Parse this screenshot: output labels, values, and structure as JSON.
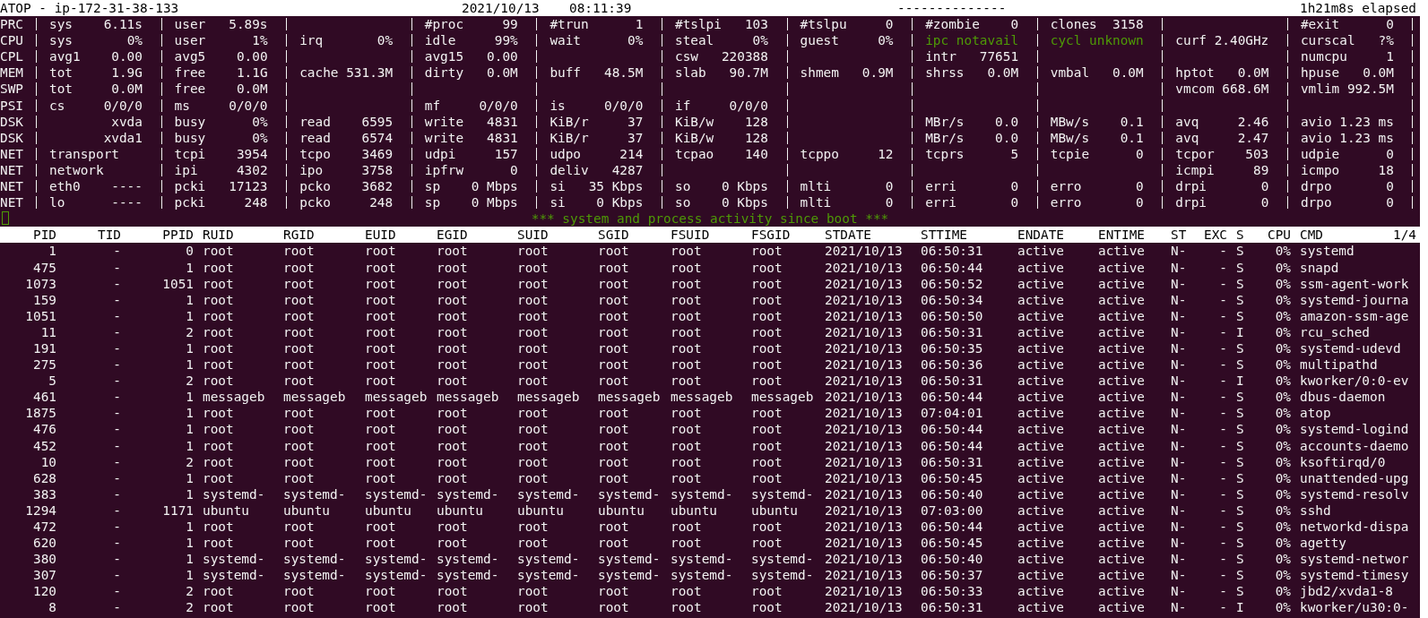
{
  "title_bar": {
    "title": "ATOP - ip-172-31-38-133",
    "date": "2021/10/13",
    "time": "08:11:39",
    "separator": "--------------",
    "elapsed": "1h21m8s elapsed"
  },
  "system_rows": [
    {
      "label": "PRC",
      "cells": [
        {
          "kind": "metric",
          "name": "sys",
          "value": "6.11s"
        },
        {
          "kind": "metric",
          "name": "user",
          "value": "5.89s"
        },
        {
          "kind": "blank"
        },
        {
          "kind": "metric",
          "name": "#proc",
          "value": "99"
        },
        {
          "kind": "metric",
          "name": "#trun",
          "value": "1"
        },
        {
          "kind": "metric",
          "name": "#tslpi",
          "value": "103"
        },
        {
          "kind": "metric",
          "name": "#tslpu",
          "value": "0"
        },
        {
          "kind": "metric",
          "name": "#zombie",
          "value": "0"
        },
        {
          "kind": "metric",
          "name": "clones",
          "value": "3158"
        },
        {
          "kind": "blank"
        },
        {
          "kind": "metric",
          "name": "#exit",
          "value": "0"
        }
      ]
    },
    {
      "label": "CPU",
      "cells": [
        {
          "kind": "metric",
          "name": "sys",
          "value": "0%"
        },
        {
          "kind": "metric",
          "name": "user",
          "value": "1%"
        },
        {
          "kind": "metric",
          "name": "irq",
          "value": "0%"
        },
        {
          "kind": "metric",
          "name": "idle",
          "value": "99%"
        },
        {
          "kind": "metric",
          "name": "wait",
          "value": "0%"
        },
        {
          "kind": "metric",
          "name": "steal",
          "value": "0%"
        },
        {
          "kind": "metric",
          "name": "guest",
          "value": "0%"
        },
        {
          "kind": "notice",
          "text": "ipc notavail"
        },
        {
          "kind": "notice",
          "text": "cycl unknown"
        },
        {
          "kind": "metric",
          "name": "curf",
          "value": "2.40GHz"
        },
        {
          "kind": "metric",
          "name": "curscal",
          "value": "?%"
        }
      ]
    },
    {
      "label": "CPL",
      "cells": [
        {
          "kind": "metric",
          "name": "avg1",
          "value": "0.00"
        },
        {
          "kind": "metric",
          "name": "avg5",
          "value": "0.00"
        },
        {
          "kind": "blank"
        },
        {
          "kind": "metric",
          "name": "avg15",
          "value": "0.00"
        },
        {
          "kind": "blank"
        },
        {
          "kind": "metric",
          "name": "csw",
          "value": "220388"
        },
        {
          "kind": "blank"
        },
        {
          "kind": "metric",
          "name": "intr",
          "value": "77651"
        },
        {
          "kind": "blank"
        },
        {
          "kind": "blank"
        },
        {
          "kind": "metric",
          "name": "numcpu",
          "value": "1"
        }
      ]
    },
    {
      "label": "MEM",
      "cells": [
        {
          "kind": "metric",
          "name": "tot",
          "value": "1.9G"
        },
        {
          "kind": "metric",
          "name": "free",
          "value": "1.1G"
        },
        {
          "kind": "metric",
          "name": "cache",
          "value": "531.3M"
        },
        {
          "kind": "metric",
          "name": "dirty",
          "value": "0.0M"
        },
        {
          "kind": "metric",
          "name": "buff",
          "value": "48.5M"
        },
        {
          "kind": "metric",
          "name": "slab",
          "value": "90.7M"
        },
        {
          "kind": "metric",
          "name": "shmem",
          "value": "0.9M"
        },
        {
          "kind": "metric",
          "name": "shrss",
          "value": "0.0M"
        },
        {
          "kind": "metric",
          "name": "vmbal",
          "value": "0.0M"
        },
        {
          "kind": "metric",
          "name": "hptot",
          "value": "0.0M"
        },
        {
          "kind": "metric",
          "name": "hpuse",
          "value": "0.0M"
        }
      ]
    },
    {
      "label": "SWP",
      "cells": [
        {
          "kind": "metric",
          "name": "tot",
          "value": "0.0M"
        },
        {
          "kind": "metric",
          "name": "free",
          "value": "0.0M"
        },
        {
          "kind": "blank"
        },
        {
          "kind": "blank"
        },
        {
          "kind": "blank"
        },
        {
          "kind": "blank"
        },
        {
          "kind": "blank"
        },
        {
          "kind": "blank"
        },
        {
          "kind": "blank"
        },
        {
          "kind": "metric",
          "name": "vmcom",
          "value": "668.6M"
        },
        {
          "kind": "metric",
          "name": "vmlim",
          "value": "992.5M"
        }
      ]
    },
    {
      "label": "PSI",
      "cells": [
        {
          "kind": "metric",
          "name": "cs",
          "value": "0/0/0"
        },
        {
          "kind": "metric",
          "name": "ms",
          "value": "0/0/0"
        },
        {
          "kind": "blank"
        },
        {
          "kind": "metric",
          "name": "mf",
          "value": "0/0/0"
        },
        {
          "kind": "metric",
          "name": "is",
          "value": "0/0/0"
        },
        {
          "kind": "metric",
          "name": "if",
          "value": "0/0/0"
        },
        {
          "kind": "blank"
        },
        {
          "kind": "blank"
        },
        {
          "kind": "blank"
        },
        {
          "kind": "blank"
        },
        {
          "kind": "blank"
        }
      ]
    },
    {
      "label": "DSK",
      "cells": [
        {
          "kind": "metric",
          "value": "xvda"
        },
        {
          "kind": "metric",
          "name": "busy",
          "value": "0%"
        },
        {
          "kind": "metric",
          "name": "read",
          "value": "6595"
        },
        {
          "kind": "metric",
          "name": "write",
          "value": "4831"
        },
        {
          "kind": "metric",
          "name": "KiB/r",
          "value": "37"
        },
        {
          "kind": "metric",
          "name": "KiB/w",
          "value": "128"
        },
        {
          "kind": "blank"
        },
        {
          "kind": "metric",
          "name": "MBr/s",
          "value": "0.0"
        },
        {
          "kind": "metric",
          "name": "MBw/s",
          "value": "0.1"
        },
        {
          "kind": "metric",
          "name": "avq",
          "value": "2.46"
        },
        {
          "kind": "metric",
          "name": "avio",
          "value": "1.23 ms"
        }
      ]
    },
    {
      "label": "DSK",
      "cells": [
        {
          "kind": "metric",
          "value": "xvda1"
        },
        {
          "kind": "metric",
          "name": "busy",
          "value": "0%"
        },
        {
          "kind": "metric",
          "name": "read",
          "value": "6574"
        },
        {
          "kind": "metric",
          "name": "write",
          "value": "4831"
        },
        {
          "kind": "metric",
          "name": "KiB/r",
          "value": "37"
        },
        {
          "kind": "metric",
          "name": "KiB/w",
          "value": "128"
        },
        {
          "kind": "blank"
        },
        {
          "kind": "metric",
          "name": "MBr/s",
          "value": "0.0"
        },
        {
          "kind": "metric",
          "name": "MBw/s",
          "value": "0.1"
        },
        {
          "kind": "metric",
          "name": "avq",
          "value": "2.47"
        },
        {
          "kind": "metric",
          "name": "avio",
          "value": "1.23 ms"
        }
      ]
    },
    {
      "label": "NET",
      "cells": [
        {
          "kind": "label",
          "text": "transport"
        },
        {
          "kind": "metric",
          "name": "tcpi",
          "value": "3954"
        },
        {
          "kind": "metric",
          "name": "tcpo",
          "value": "3469"
        },
        {
          "kind": "metric",
          "name": "udpi",
          "value": "157"
        },
        {
          "kind": "metric",
          "name": "udpo",
          "value": "214"
        },
        {
          "kind": "metric",
          "name": "tcpao",
          "value": "140"
        },
        {
          "kind": "metric",
          "name": "tcppo",
          "value": "12"
        },
        {
          "kind": "metric",
          "name": "tcprs",
          "value": "5"
        },
        {
          "kind": "metric",
          "name": "tcpie",
          "value": "0"
        },
        {
          "kind": "metric",
          "name": "tcpor",
          "value": "503"
        },
        {
          "kind": "metric",
          "name": "udpie",
          "value": "0"
        }
      ]
    },
    {
      "label": "NET",
      "cells": [
        {
          "kind": "label",
          "text": "network"
        },
        {
          "kind": "metric",
          "name": "ipi",
          "value": "4302"
        },
        {
          "kind": "metric",
          "name": "ipo",
          "value": "3758"
        },
        {
          "kind": "metric",
          "name": "ipfrw",
          "value": "0"
        },
        {
          "kind": "metric",
          "name": "deliv",
          "value": "4287"
        },
        {
          "kind": "blank"
        },
        {
          "kind": "blank"
        },
        {
          "kind": "blank"
        },
        {
          "kind": "blank"
        },
        {
          "kind": "metric",
          "name": "icmpi",
          "value": "89"
        },
        {
          "kind": "metric",
          "name": "icmpo",
          "value": "18"
        }
      ]
    },
    {
      "label": "NET",
      "cells": [
        {
          "kind": "metric",
          "name": "eth0",
          "value": "----"
        },
        {
          "kind": "metric",
          "name": "pcki",
          "value": "17123"
        },
        {
          "kind": "metric",
          "name": "pcko",
          "value": "3682"
        },
        {
          "kind": "metric",
          "name": "sp",
          "value": "0 Mbps"
        },
        {
          "kind": "metric",
          "name": "si",
          "value": "35 Kbps"
        },
        {
          "kind": "metric",
          "name": "so",
          "value": "0 Kbps"
        },
        {
          "kind": "metric",
          "name": "mlti",
          "value": "0"
        },
        {
          "kind": "metric",
          "name": "erri",
          "value": "0"
        },
        {
          "kind": "metric",
          "name": "erro",
          "value": "0"
        },
        {
          "kind": "metric",
          "name": "drpi",
          "value": "0"
        },
        {
          "kind": "metric",
          "name": "drpo",
          "value": "0"
        }
      ]
    },
    {
      "label": "NET",
      "cells": [
        {
          "kind": "metric",
          "name": "lo",
          "value": "----"
        },
        {
          "kind": "metric",
          "name": "pcki",
          "value": "248"
        },
        {
          "kind": "metric",
          "name": "pcko",
          "value": "248"
        },
        {
          "kind": "metric",
          "name": "sp",
          "value": "0 Mbps"
        },
        {
          "kind": "metric",
          "name": "si",
          "value": "0 Kbps"
        },
        {
          "kind": "metric",
          "name": "so",
          "value": "0 Kbps"
        },
        {
          "kind": "metric",
          "name": "mlti",
          "value": "0"
        },
        {
          "kind": "metric",
          "name": "erri",
          "value": "0"
        },
        {
          "kind": "metric",
          "name": "erro",
          "value": "0"
        },
        {
          "kind": "metric",
          "name": "drpi",
          "value": "0"
        },
        {
          "kind": "metric",
          "name": "drpo",
          "value": "0"
        }
      ]
    }
  ],
  "banner": "*** system and process activity since boot ***",
  "process_table": {
    "columns": [
      "PID",
      "TID",
      "PPID",
      "RUID",
      "RGID",
      "EUID",
      "EGID",
      "SUID",
      "SGID",
      "FSUID",
      "FSGID",
      "STDATE",
      "STTIME",
      "ENDATE",
      "ENTIME",
      "ST",
      "EXC",
      "S",
      "CPU",
      "CMD"
    ],
    "page": "1/4",
    "rows": [
      [
        "1",
        "-",
        "0",
        "root",
        "root",
        "root",
        "root",
        "root",
        "root",
        "root",
        "root",
        "2021/10/13",
        "06:50:31",
        "active",
        "active",
        "N-",
        "-",
        "S",
        "0%",
        "systemd"
      ],
      [
        "475",
        "-",
        "1",
        "root",
        "root",
        "root",
        "root",
        "root",
        "root",
        "root",
        "root",
        "2021/10/13",
        "06:50:44",
        "active",
        "active",
        "N-",
        "-",
        "S",
        "0%",
        "snapd"
      ],
      [
        "1073",
        "-",
        "1051",
        "root",
        "root",
        "root",
        "root",
        "root",
        "root",
        "root",
        "root",
        "2021/10/13",
        "06:50:52",
        "active",
        "active",
        "N-",
        "-",
        "S",
        "0%",
        "ssm-agent-work"
      ],
      [
        "159",
        "-",
        "1",
        "root",
        "root",
        "root",
        "root",
        "root",
        "root",
        "root",
        "root",
        "2021/10/13",
        "06:50:34",
        "active",
        "active",
        "N-",
        "-",
        "S",
        "0%",
        "systemd-journa"
      ],
      [
        "1051",
        "-",
        "1",
        "root",
        "root",
        "root",
        "root",
        "root",
        "root",
        "root",
        "root",
        "2021/10/13",
        "06:50:50",
        "active",
        "active",
        "N-",
        "-",
        "S",
        "0%",
        "amazon-ssm-age"
      ],
      [
        "11",
        "-",
        "2",
        "root",
        "root",
        "root",
        "root",
        "root",
        "root",
        "root",
        "root",
        "2021/10/13",
        "06:50:31",
        "active",
        "active",
        "N-",
        "-",
        "I",
        "0%",
        "rcu_sched"
      ],
      [
        "191",
        "-",
        "1",
        "root",
        "root",
        "root",
        "root",
        "root",
        "root",
        "root",
        "root",
        "2021/10/13",
        "06:50:35",
        "active",
        "active",
        "N-",
        "-",
        "S",
        "0%",
        "systemd-udevd"
      ],
      [
        "275",
        "-",
        "1",
        "root",
        "root",
        "root",
        "root",
        "root",
        "root",
        "root",
        "root",
        "2021/10/13",
        "06:50:36",
        "active",
        "active",
        "N-",
        "-",
        "S",
        "0%",
        "multipathd"
      ],
      [
        "5",
        "-",
        "2",
        "root",
        "root",
        "root",
        "root",
        "root",
        "root",
        "root",
        "root",
        "2021/10/13",
        "06:50:31",
        "active",
        "active",
        "N-",
        "-",
        "I",
        "0%",
        "kworker/0:0-ev"
      ],
      [
        "461",
        "-",
        "1",
        "messageb",
        "messageb",
        "messageb",
        "messageb",
        "messageb",
        "messageb",
        "messageb",
        "messageb",
        "2021/10/13",
        "06:50:44",
        "active",
        "active",
        "N-",
        "-",
        "S",
        "0%",
        "dbus-daemon"
      ],
      [
        "1875",
        "-",
        "1",
        "root",
        "root",
        "root",
        "root",
        "root",
        "root",
        "root",
        "root",
        "2021/10/13",
        "07:04:01",
        "active",
        "active",
        "N-",
        "-",
        "S",
        "0%",
        "atop"
      ],
      [
        "476",
        "-",
        "1",
        "root",
        "root",
        "root",
        "root",
        "root",
        "root",
        "root",
        "root",
        "2021/10/13",
        "06:50:44",
        "active",
        "active",
        "N-",
        "-",
        "S",
        "0%",
        "systemd-logind"
      ],
      [
        "452",
        "-",
        "1",
        "root",
        "root",
        "root",
        "root",
        "root",
        "root",
        "root",
        "root",
        "2021/10/13",
        "06:50:44",
        "active",
        "active",
        "N-",
        "-",
        "S",
        "0%",
        "accounts-daemo"
      ],
      [
        "10",
        "-",
        "2",
        "root",
        "root",
        "root",
        "root",
        "root",
        "root",
        "root",
        "root",
        "2021/10/13",
        "06:50:31",
        "active",
        "active",
        "N-",
        "-",
        "S",
        "0%",
        "ksoftirqd/0"
      ],
      [
        "628",
        "-",
        "1",
        "root",
        "root",
        "root",
        "root",
        "root",
        "root",
        "root",
        "root",
        "2021/10/13",
        "06:50:45",
        "active",
        "active",
        "N-",
        "-",
        "S",
        "0%",
        "unattended-upg"
      ],
      [
        "383",
        "-",
        "1",
        "systemd-",
        "systemd-",
        "systemd-",
        "systemd-",
        "systemd-",
        "systemd-",
        "systemd-",
        "systemd-",
        "2021/10/13",
        "06:50:40",
        "active",
        "active",
        "N-",
        "-",
        "S",
        "0%",
        "systemd-resolv"
      ],
      [
        "1294",
        "-",
        "1171",
        "ubuntu",
        "ubuntu",
        "ubuntu",
        "ubuntu",
        "ubuntu",
        "ubuntu",
        "ubuntu",
        "ubuntu",
        "2021/10/13",
        "07:03:00",
        "active",
        "active",
        "N-",
        "-",
        "S",
        "0%",
        "sshd"
      ],
      [
        "472",
        "-",
        "1",
        "root",
        "root",
        "root",
        "root",
        "root",
        "root",
        "root",
        "root",
        "2021/10/13",
        "06:50:44",
        "active",
        "active",
        "N-",
        "-",
        "S",
        "0%",
        "networkd-dispa"
      ],
      [
        "620",
        "-",
        "1",
        "root",
        "root",
        "root",
        "root",
        "root",
        "root",
        "root",
        "root",
        "2021/10/13",
        "06:50:45",
        "active",
        "active",
        "N-",
        "-",
        "S",
        "0%",
        "agetty"
      ],
      [
        "380",
        "-",
        "1",
        "systemd-",
        "systemd-",
        "systemd-",
        "systemd-",
        "systemd-",
        "systemd-",
        "systemd-",
        "systemd-",
        "2021/10/13",
        "06:50:40",
        "active",
        "active",
        "N-",
        "-",
        "S",
        "0%",
        "systemd-networ"
      ],
      [
        "307",
        "-",
        "1",
        "systemd-",
        "systemd-",
        "systemd-",
        "systemd-",
        "systemd-",
        "systemd-",
        "systemd-",
        "systemd-",
        "2021/10/13",
        "06:50:37",
        "active",
        "active",
        "N-",
        "-",
        "S",
        "0%",
        "systemd-timesy"
      ],
      [
        "120",
        "-",
        "2",
        "root",
        "root",
        "root",
        "root",
        "root",
        "root",
        "root",
        "root",
        "2021/10/13",
        "06:50:33",
        "active",
        "active",
        "N-",
        "-",
        "S",
        "0%",
        "jbd2/xvda1-8"
      ],
      [
        "8",
        "-",
        "2",
        "root",
        "root",
        "root",
        "root",
        "root",
        "root",
        "root",
        "root",
        "2021/10/13",
        "06:50:31",
        "active",
        "active",
        "N-",
        "-",
        "I",
        "0%",
        "kworker/u30:0-"
      ]
    ]
  }
}
